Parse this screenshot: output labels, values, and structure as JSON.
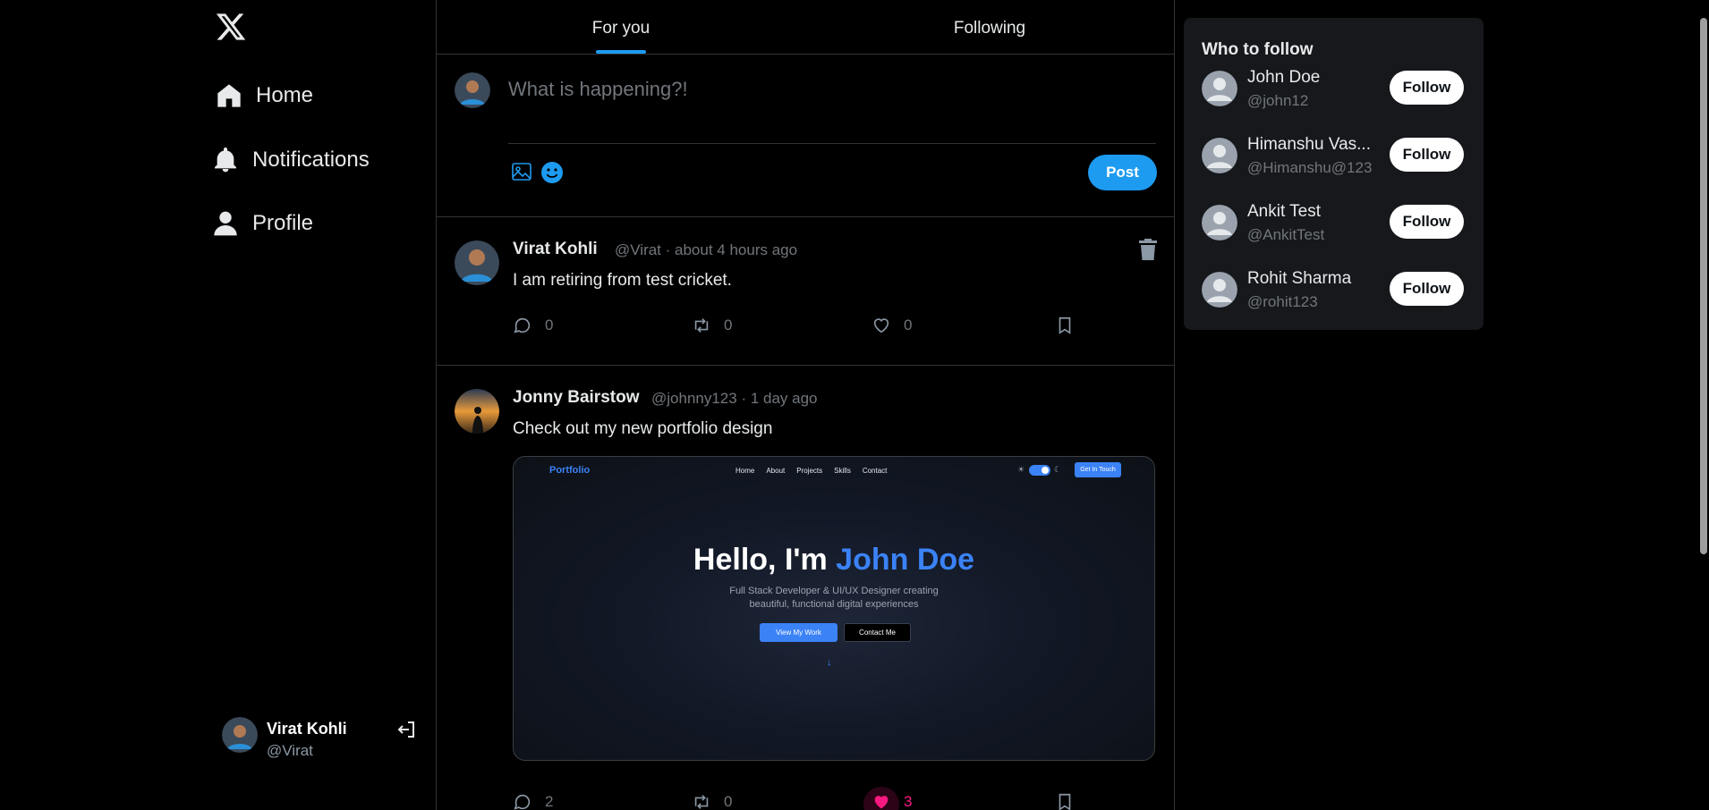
{
  "nav": {
    "items": [
      {
        "label": "Home",
        "icon": "home-icon"
      },
      {
        "label": "Notifications",
        "icon": "bell-icon"
      },
      {
        "label": "Profile",
        "icon": "user-icon"
      }
    ]
  },
  "current_user": {
    "name": "Virat Kohli",
    "handle": "@Virat"
  },
  "tabs": [
    {
      "label": "For you",
      "active": true
    },
    {
      "label": "Following",
      "active": false
    }
  ],
  "compose": {
    "placeholder": "What is happening?!",
    "post_label": "Post"
  },
  "tweets": [
    {
      "name": "Virat Kohli",
      "meta": "@Virat · about 4 hours ago",
      "text": "I am retiring from test cricket.",
      "replies": "0",
      "retweets": "0",
      "likes": "0"
    },
    {
      "name": "Jonny Bairstow",
      "meta": "@johnny123 · 1 day ago",
      "text": "Check out my new portfolio design",
      "replies": "2",
      "retweets": "0",
      "likes": "3",
      "image": {
        "brand": "Portfolio",
        "nav": [
          "Home",
          "About",
          "Projects",
          "Skills",
          "Contact"
        ],
        "cta": "Get In Touch",
        "headline_prefix": "Hello, I'm",
        "headline_name": "John Doe",
        "sub_line1": "Full Stack Developer & UI/UX Designer creating",
        "sub_line2": "beautiful, functional digital experiences",
        "btn_primary": "View My Work",
        "btn_secondary": "Contact Me"
      }
    }
  ],
  "who_to_follow": {
    "title": "Who to follow",
    "follow_label": "Follow",
    "users": [
      {
        "name": "John Doe",
        "handle": "@john12"
      },
      {
        "name": "Himanshu Vas...",
        "handle": "@Himanshu@123"
      },
      {
        "name": "Ankit Test",
        "handle": "@AnkitTest"
      },
      {
        "name": "Rohit Sharma",
        "handle": "@rohit123"
      }
    ]
  },
  "colors": {
    "accent": "#1d9bf0",
    "like": "#f91880",
    "background": "#000000"
  }
}
